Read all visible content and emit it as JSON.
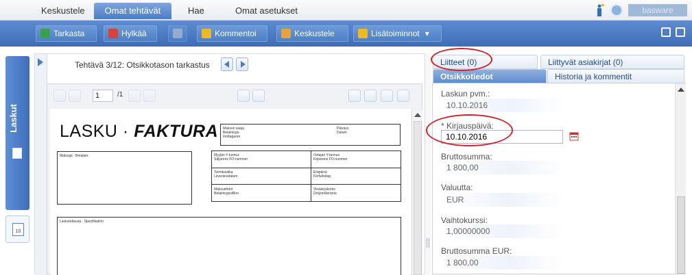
{
  "topnav": {
    "tabs": [
      {
        "label": "Keskustele"
      },
      {
        "label": "Omat tehtävät",
        "active": true
      },
      {
        "label": "Hae"
      },
      {
        "label": "Omat asetukset"
      }
    ],
    "brand": "basware"
  },
  "toolbar": {
    "buttons": [
      {
        "label": "Tarkasta",
        "icon": "check-doc-icon"
      },
      {
        "label": "Hylkää",
        "icon": "reject-doc-icon"
      },
      {
        "label": "",
        "icon": "flag-icon"
      },
      {
        "label": "Kommentoi",
        "icon": "comment-icon"
      },
      {
        "label": "Keskustele",
        "icon": "discussion-icon"
      },
      {
        "label": "Lisätoiminnot",
        "icon": "more-actions-icon"
      }
    ]
  },
  "sidebar": {
    "label": "Laskut",
    "calendar_day": "10"
  },
  "task": {
    "title": "Tehtävä 3/12: Otsikkotason tarkastus"
  },
  "viewer": {
    "page_current": "1",
    "page_total": "/1"
  },
  "invoice": {
    "logo_left": "LASKU · ",
    "logo_right": "FAKTURA",
    "hdr_cells": [
      "Maksun saaja\nBetalnings-\nmottagaren",
      "Päiväys\nDatum"
    ],
    "addr_label": "Maksaja · Betalare",
    "grid_cells": [
      "Myyjän Y-tunnus\nSäljarens FO-nummer",
      "Ostajan Y-tunnus\nKöparens FO-nummer",
      "Toimitusaika\nLeveransdatum",
      "Eräpäivä\nFörfallodag",
      "Maksuehdot\nBetalningsvillkor",
      "Viivästyskorko\nDröjsmålsränta"
    ],
    "spec_label": "Laskutettavaa · Specifikation"
  },
  "right": {
    "tabs_row1": [
      {
        "label": "Liitteet (0)"
      },
      {
        "label": "Liittyvät asiakirjat (0)"
      }
    ],
    "tabs_row2": [
      {
        "label": "Otsikkotiedot",
        "active": true
      },
      {
        "label": "Historia ja kommentit"
      }
    ],
    "fields": [
      {
        "label": "Laskun pvm.:",
        "value": "10.10.2016",
        "editable": false
      },
      {
        "label": "* Kirjauspäivä:",
        "value": "10.10.2016",
        "editable": true
      },
      {
        "label": "Bruttosumma:",
        "value": "1 800,00",
        "editable": false
      },
      {
        "label": "Valuutta:",
        "value": "EUR",
        "editable": false
      },
      {
        "label": "Vaihtokurssi:",
        "value": "1,00000000",
        "editable": false
      },
      {
        "label": "Bruttosumma EUR:",
        "value": "1 800,00",
        "editable": false
      }
    ]
  },
  "colors": {
    "primary": "#4a7cc8",
    "toolbar": "#3e6db7",
    "highlight_ellipse": "#d0242a"
  }
}
